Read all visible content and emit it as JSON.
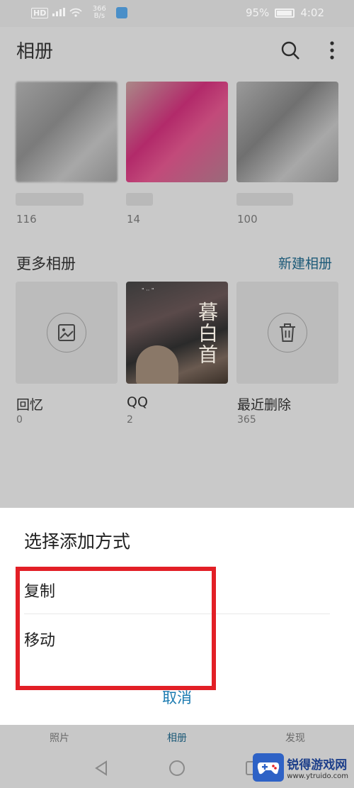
{
  "status_bar": {
    "hd": "HD",
    "network_speed": "366 B/s",
    "battery": "95%",
    "battery_level": 0.95,
    "time": "4:02"
  },
  "app_bar": {
    "title": "相册",
    "search_icon": "search-icon",
    "more_icon": "more-vertical-icon"
  },
  "top_albums": [
    {
      "count": "116"
    },
    {
      "count": "14"
    },
    {
      "count": "100"
    }
  ],
  "more_albums": {
    "title": "更多相册",
    "new_album": "新建相册",
    "items": [
      {
        "name": "回忆",
        "count": "0",
        "icon": "image-icon"
      },
      {
        "name": "QQ",
        "count": "2",
        "poster_text": "暮白首"
      },
      {
        "name": "最近删除",
        "count": "365",
        "icon": "trash-icon"
      }
    ]
  },
  "sheet": {
    "title": "选择添加方式",
    "options": [
      "复制",
      "移动"
    ],
    "cancel": "取消",
    "highlight_color": "#e21f26",
    "accent_color": "#1a7ab0"
  },
  "bottom_nav": {
    "tabs": [
      "照片",
      "相册",
      "发现"
    ],
    "active": "相册"
  },
  "watermark": {
    "title": "锐得游戏网",
    "url": "www.ytruido.com"
  }
}
